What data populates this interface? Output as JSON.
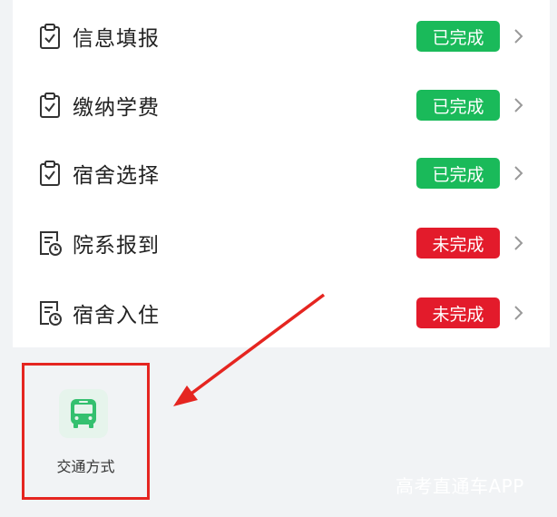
{
  "steps": [
    {
      "label": "信息填报",
      "status": "已完成",
      "icon": "clipboard-check-icon"
    },
    {
      "label": "缴纳学费",
      "status": "已完成",
      "icon": "clipboard-check-icon"
    },
    {
      "label": "宿舍选择",
      "status": "已完成",
      "icon": "clipboard-check-icon"
    },
    {
      "label": "院系报到",
      "status": "未完成",
      "icon": "document-clock-icon"
    },
    {
      "label": "宿舍入住",
      "status": "未完成",
      "icon": "document-clock-icon"
    }
  ],
  "transport": {
    "label": "交通方式",
    "icon": "bus-icon"
  },
  "watermark": "高考直通车APP",
  "colors": {
    "done": "#1aba5a",
    "todo": "#e31b2b",
    "highlight": "#e52520",
    "bus": "#34c06f",
    "tile_bg": "#e6f4ec"
  }
}
